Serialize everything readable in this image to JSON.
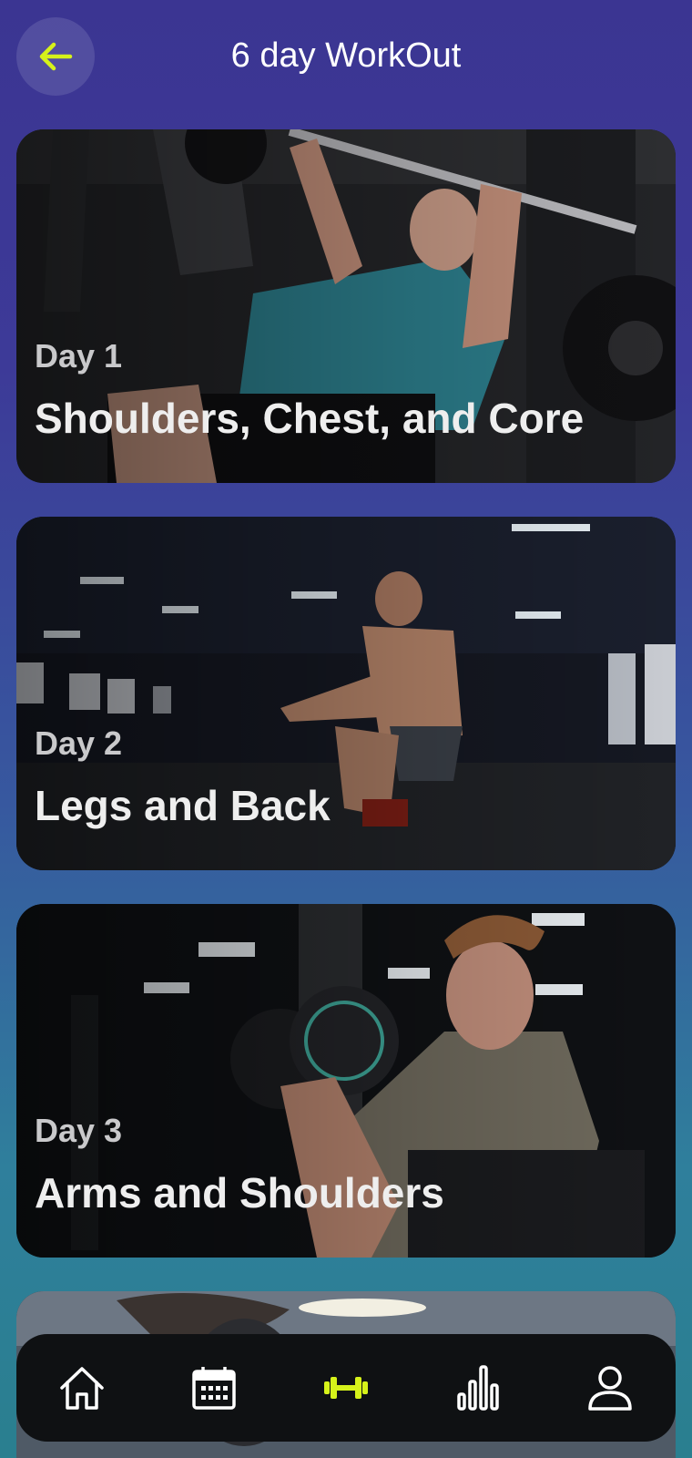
{
  "header": {
    "title": "6 day WorkOut",
    "back_icon": "arrow-left-icon",
    "accent_color": "#d6f21a"
  },
  "workouts": [
    {
      "day": "Day 1",
      "name": "Shoulders, Chest, and Core"
    },
    {
      "day": "Day 2",
      "name": "Legs and Back"
    },
    {
      "day": "Day 3",
      "name": "Arms and Shoulders"
    }
  ],
  "bottom_nav": {
    "items": [
      {
        "icon": "home-icon",
        "active": false
      },
      {
        "icon": "calendar-icon",
        "active": false
      },
      {
        "icon": "dumbbell-icon",
        "active": true
      },
      {
        "icon": "bar-chart-icon",
        "active": false
      },
      {
        "icon": "profile-icon",
        "active": false
      }
    ],
    "active_color": "#d6f21a",
    "inactive_color": "#ffffff"
  }
}
